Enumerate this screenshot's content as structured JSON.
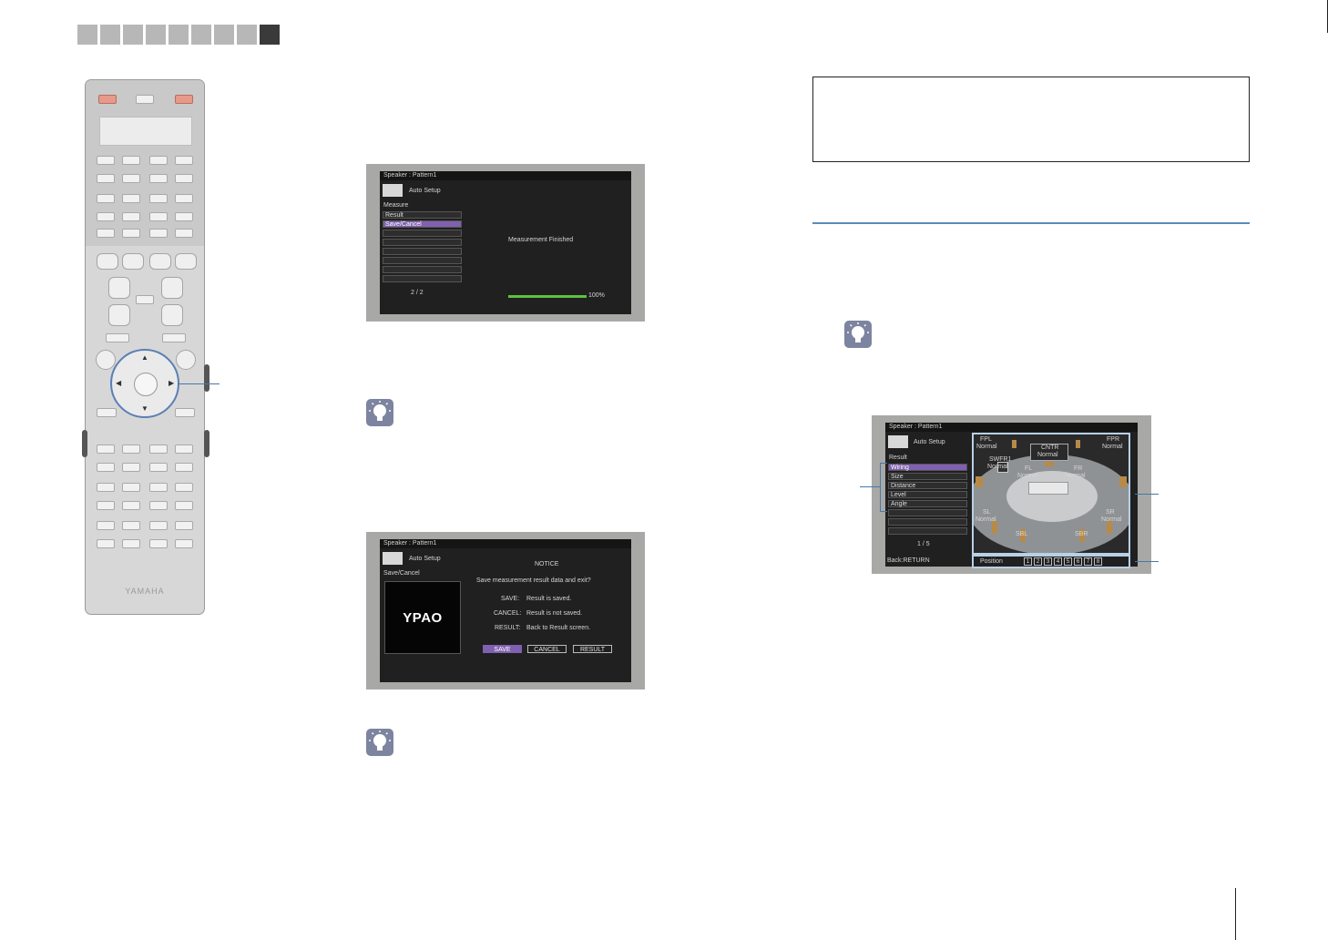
{
  "tabs": {
    "count": 9,
    "active_index": 8
  },
  "remote": {
    "brand": "YAMAHA"
  },
  "screen1": {
    "title": "Speaker : Pattern1",
    "header": "Auto Setup",
    "section": "Measure",
    "items": [
      "Result",
      "Save/Cancel",
      "",
      "",
      "",
      "",
      "",
      ""
    ],
    "selected_index": 1,
    "page": "2 / 2",
    "status": "Measurement Finished",
    "progress_label": "100%",
    "progress": 1.0
  },
  "screen2": {
    "title": "Speaker : Pattern1",
    "header": "Auto Setup",
    "section": "Save/Cancel",
    "logo": "YPAO",
    "notice_title": "NOTICE",
    "notice_question": "Save measurement result data and exit?",
    "options": [
      {
        "key": "SAVE:",
        "desc": "Result is saved."
      },
      {
        "key": "CANCEL:",
        "desc": "Result is not saved."
      },
      {
        "key": "RESULT:",
        "desc": "Back to Result screen."
      }
    ],
    "buttons": [
      "SAVE",
      "CANCEL",
      "RESULT"
    ]
  },
  "screen3": {
    "title": "Speaker : Pattern1",
    "header": "Auto Setup",
    "section": "Result",
    "items": [
      "Wiring",
      "Size",
      "Distance",
      "Level",
      "Angle",
      "",
      "",
      ""
    ],
    "selected_index": 0,
    "page": "1 / 5",
    "back": "Back:RETURN",
    "position_label": "Position",
    "positions": [
      "1",
      "2",
      "3",
      "4",
      "5",
      "6",
      "7",
      "8"
    ],
    "speakers": {
      "fpl": "FPL",
      "fpl_s": "Normal",
      "fpr": "FPR",
      "fpr_s": "Normal",
      "cntr": "CNTR",
      "cntr_s": "Normal",
      "swfr": "SWFR1",
      "swfr_s": "Normal",
      "fl": "FL",
      "fl_s": "Normal",
      "fr": "FR",
      "fr_s": "Normal",
      "sl": "SL",
      "sl_s": "Normal",
      "sr": "SR",
      "sr_s": "Normal",
      "sbl": "SBL",
      "sbr": "SBR"
    }
  }
}
